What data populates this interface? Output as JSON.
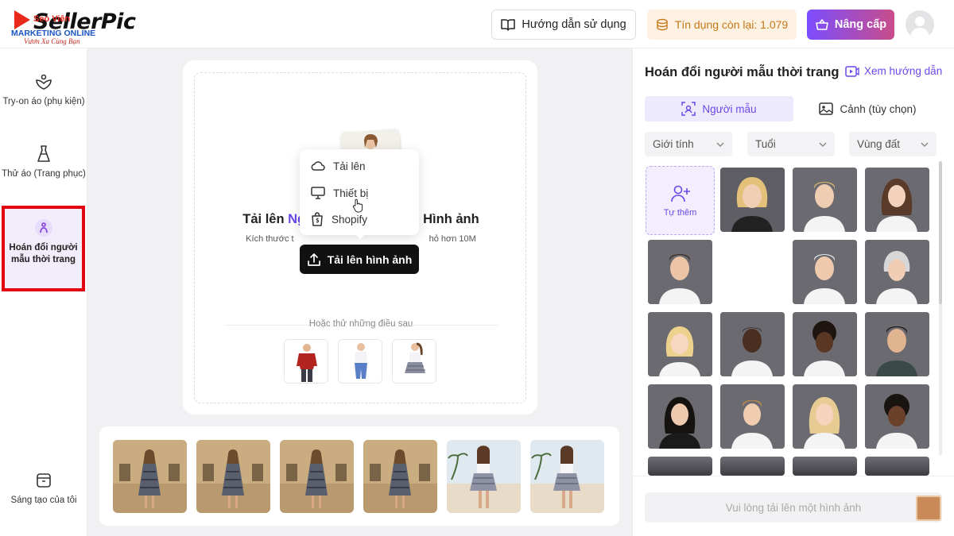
{
  "brand": {
    "logo_text": "SellerPic",
    "overlay_red": "Seo Viên",
    "overlay_blue": "MARKETING ONLINE",
    "slogan": "Vươn Xa Cùng Bạn"
  },
  "header": {
    "guide_label": "Hướng dẫn sử dụng",
    "credit_label": "Tín dụng còn lại: 1.079",
    "upgrade_label": "Nâng cấp"
  },
  "sidebar": {
    "items": [
      {
        "label": "Try-on áo (phụ kiện)",
        "icon": "accessory-icon"
      },
      {
        "label": "Thử áo (Trang phục)",
        "icon": "dress-icon"
      },
      {
        "label": "Hoán đổi người mẫu thời trang",
        "icon": "model-swap-icon",
        "active": true
      },
      {
        "label": "Sáng tạo của tôi",
        "icon": "box-icon"
      }
    ]
  },
  "upload": {
    "title_a": "Tải lên ",
    "title_hl": "Ng",
    "title_b": "Hình ảnh",
    "sub_a": "Kích thước t",
    "sub_b": "hỏ hơn 10M",
    "button_label": "Tải lên hình ảnh",
    "try_label": "Hoặc thử những điều sau"
  },
  "menu": {
    "items": [
      {
        "label": "Tải lên",
        "icon": "cloud-icon"
      },
      {
        "label": "Thiết bị",
        "icon": "monitor-icon"
      },
      {
        "label": "Shopify",
        "icon": "shopify-icon"
      }
    ]
  },
  "right_panel": {
    "title": "Hoán đổi người mẫu thời trang",
    "guide_link": "Xem hướng dẫn",
    "tabs": [
      {
        "label": "Người mẫu",
        "active": true
      },
      {
        "label": "Cảnh (tùy chọn)",
        "active": false
      }
    ],
    "filters": [
      "Giới tính",
      "Tuổi",
      "Vùng đất"
    ],
    "add_label": "Tự thêm",
    "footer_button": "Vui lòng tải lên một hình ảnh"
  },
  "colors": {
    "accent": "#6b47e8",
    "highlight_box": "#e3000f",
    "credit_text": "#c4781a"
  }
}
